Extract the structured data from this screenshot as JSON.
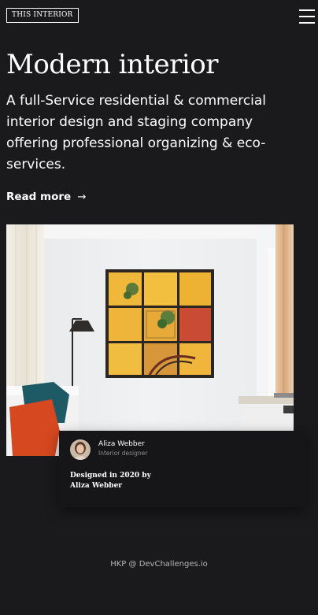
{
  "header": {
    "logo_text": "THIS INTERIOR"
  },
  "hero": {
    "title": "Modern interior",
    "description": "A full-Service residential & commercial interior design and staging company offering professional organizing & eco-services.",
    "read_more_label": "Read more",
    "read_more_arrow": "→"
  },
  "card": {
    "author_name": "Aliza Webber",
    "author_role": "Interior designer",
    "designed_text": "Designed in 2020 by Aliza Webber"
  },
  "footer": {
    "credit": "HKP @ DevChallenges.io"
  },
  "colors": {
    "background": "#1a1a1c",
    "card_background": "#161618",
    "text": "#ffffff",
    "muted_text": "#8e8e93"
  },
  "icons": {
    "menu": "hamburger-icon",
    "read_more": "arrow-right-icon"
  }
}
